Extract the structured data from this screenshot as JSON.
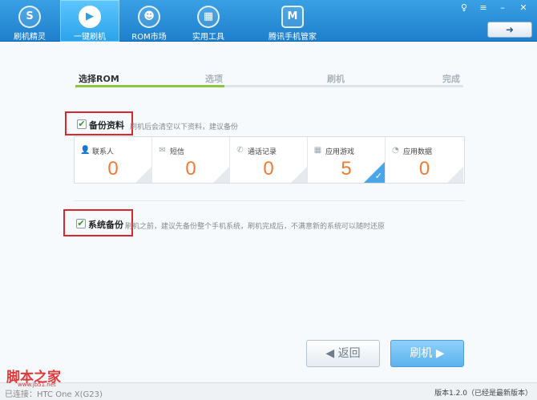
{
  "toolbar": {
    "tabs": [
      {
        "label": "刷机精灵",
        "icon": "S",
        "icon_name": "logo-icon"
      },
      {
        "label": "一键刷机",
        "icon": "▶",
        "icon_name": "play-icon"
      },
      {
        "label": "ROM市场",
        "icon": "☻",
        "icon_name": "android-icon"
      },
      {
        "label": "实用工具",
        "icon": "▦",
        "icon_name": "grid-icon"
      },
      {
        "label": "腾讯手机管家",
        "icon": "M",
        "icon_name": "shield-icon"
      }
    ],
    "active_tab": "一键刷机",
    "window_controls": {
      "feedback": "♀",
      "menu": "≡",
      "minimize": "–",
      "close": "✕"
    },
    "forward_button": "➜"
  },
  "steps": {
    "items": [
      "选择ROM",
      "选项",
      "刷机",
      "完成"
    ],
    "current": "选择ROM"
  },
  "backup_data": {
    "checked": true,
    "check_mark": "✔",
    "title": "备份资料",
    "description": "刷机后会清空以下资料，建议备份",
    "items": [
      {
        "label": "联系人",
        "value": "0",
        "icon": "👤",
        "icon_name": "contact-icon",
        "selected": false
      },
      {
        "label": "短信",
        "value": "0",
        "icon": "✉",
        "icon_name": "sms-icon",
        "selected": false
      },
      {
        "label": "通话记录",
        "value": "0",
        "icon": "✆",
        "icon_name": "phone-icon",
        "selected": false
      },
      {
        "label": "应用游戏",
        "value": "5",
        "icon": "▦",
        "icon_name": "apps-icon",
        "selected": true
      },
      {
        "label": "应用数据",
        "value": "0",
        "icon": "◔",
        "icon_name": "pie-icon",
        "selected": false
      }
    ]
  },
  "system_backup": {
    "checked": true,
    "check_mark": "✔",
    "title": "系统备份",
    "description": "刷机之前，建议先备份整个手机系统，刷机完成后，不满意新的系统可以随时还原"
  },
  "buttons": {
    "back": "◀  返回",
    "flash": "刷机  ▶"
  },
  "status": {
    "connection": "已连接：HTC One X(G23)",
    "version": "版本1.2.0（已经是最新版本）"
  },
  "watermark": {
    "text": "脚本之家",
    "url": "www.jb51.net"
  },
  "colors": {
    "toolbar": "#2a8fd8",
    "progress": "#8bc540",
    "value": "#f07b32",
    "selected": "#4ba6e8",
    "highlight_box": "#d9272e"
  }
}
